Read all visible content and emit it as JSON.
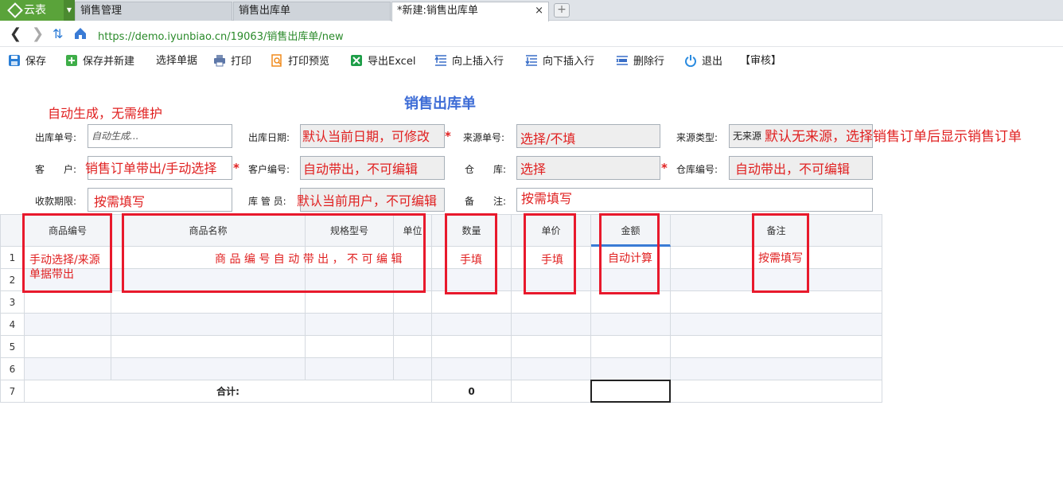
{
  "tabs": {
    "logo_label": "云表",
    "items": [
      {
        "label": "销售管理"
      },
      {
        "label": "销售出库单"
      },
      {
        "label": "*新建:销售出库单"
      }
    ],
    "close_glyph": "×",
    "new_tab_glyph": "+"
  },
  "address": {
    "url": "https://demo.iyunbiao.cn/19063/销售出库单/new"
  },
  "toolbar": {
    "save": "保存",
    "save_new": "保存并新建",
    "select_doc": "选择单据",
    "print": "打印",
    "print_preview": "打印预览",
    "export_excel": "导出Excel",
    "insert_up": "向上插入行",
    "insert_down": "向下插入行",
    "delete_row": "删除行",
    "exit": "退出",
    "audit": "【审核】"
  },
  "form": {
    "title": "销售出库单",
    "labels": {
      "order_no": "出库单号:",
      "out_date": "出库日期:",
      "source_no": "来源单号:",
      "source_type": "来源类型:",
      "customer": "客　　户:",
      "customer_code": "客户编号:",
      "warehouse": "仓　　库:",
      "warehouse_code": "仓库编号:",
      "payment_term": "收款期限:",
      "keeper": "库 管 员:",
      "remark": "备　　注:"
    },
    "values": {
      "order_no_placeholder": "自动生成...",
      "source_type_value": "无来源"
    },
    "annotations": {
      "auto_gen": "自动生成，无需维护",
      "out_date": "默认当前日期，可修改",
      "source_no": "选择/不填",
      "source_type": "默认无来源，选择销售订单后显示销售订单",
      "customer": "销售订单带出/手动选择",
      "customer_code": "自动带出，不可编辑",
      "warehouse": "选择",
      "warehouse_code": "自动带出，不可编辑",
      "payment_term": "按需填写",
      "keeper": "默认当前用户，不可编辑",
      "remark": "按需填写"
    },
    "required_mark": "*"
  },
  "grid": {
    "columns": [
      "商品编号",
      "商品名称",
      "规格型号",
      "单位",
      "数量",
      "单价",
      "金额",
      "备注"
    ],
    "row_numbers": [
      "1",
      "2",
      "3",
      "4",
      "5",
      "6",
      "7"
    ],
    "total_label": "合计:",
    "total_qty": "0",
    "annotations": {
      "code": "手动选择/来源单据带出",
      "name": "商 品 编 号 自 动 带 出 ， 不 可 编 辑",
      "qty": "手填",
      "price": "手填",
      "amount": "自动计算",
      "remark": "按需填写"
    }
  },
  "colors": {
    "logo_green": "#5aa33a",
    "title_blue": "#3d6cd6",
    "annotation_red": "#e02020",
    "highlight_red": "#e8192c"
  }
}
